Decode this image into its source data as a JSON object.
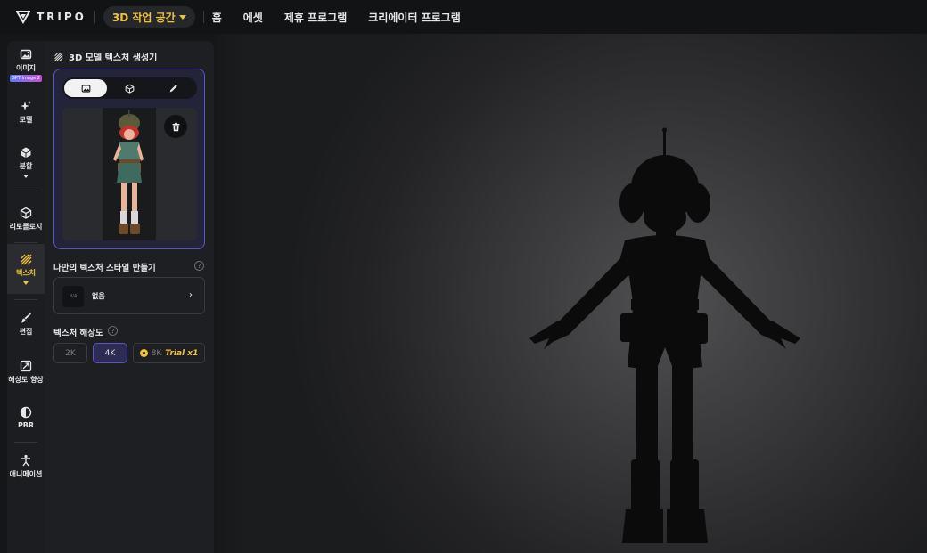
{
  "brand": {
    "name": "TRIPO"
  },
  "header": {
    "workspace_label": "3D 작업 공간",
    "nav": [
      {
        "label": "홈"
      },
      {
        "label": "에셋"
      },
      {
        "label": "제휴 프로그램"
      },
      {
        "label": "크리에이터 프로그램"
      }
    ]
  },
  "sidebar": {
    "items": [
      {
        "label": "이미지",
        "tag": "GPT Image 2",
        "icon": "image-icon"
      },
      {
        "label": "모델",
        "icon": "sparkle-icon"
      },
      {
        "label": "분할",
        "icon": "cube-icon",
        "has_dropdown": true
      },
      {
        "label": "리토폴로지",
        "icon": "mesh-icon"
      },
      {
        "label": "텍스처",
        "icon": "texture-icon",
        "has_dropdown": true,
        "active": true
      },
      {
        "label": "편집",
        "icon": "brush-icon"
      },
      {
        "label": "해상도 향상",
        "icon": "upscale-icon"
      },
      {
        "label": "PBR",
        "icon": "half-circle-icon"
      },
      {
        "label": "애니메이션",
        "icon": "figure-icon"
      }
    ]
  },
  "panel": {
    "title": "3D 모델 텍스처 생성기",
    "mode_tabs": [
      {
        "icon": "image-icon",
        "active": true
      },
      {
        "icon": "cube-icon"
      },
      {
        "icon": "pen-icon"
      }
    ],
    "style_section": {
      "label": "나만의 텍스처 스타일 만들기",
      "help": "?",
      "na_text": "N/A",
      "value": "없음",
      "chevron": "›"
    },
    "resolution": {
      "label": "텍스처 해상도",
      "help": "?",
      "options": [
        {
          "label": "2K"
        },
        {
          "label": "4K",
          "active": true
        },
        {
          "label": "8K",
          "trial": "Trial x1"
        }
      ]
    }
  },
  "colors": {
    "accent": "#f0c23c",
    "selection": "#5c54c8",
    "background": "#151618",
    "panel": "#1e1f22"
  }
}
